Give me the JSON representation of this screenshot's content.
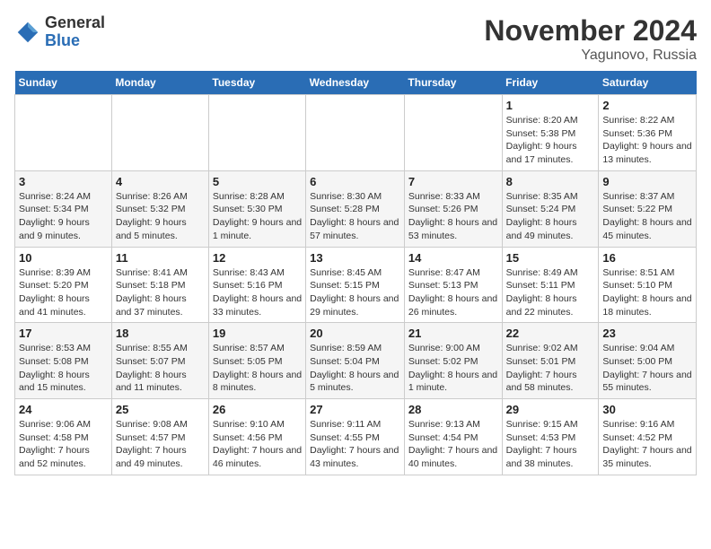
{
  "header": {
    "logo_general": "General",
    "logo_blue": "Blue",
    "month_title": "November 2024",
    "location": "Yagunovo, Russia"
  },
  "days_of_week": [
    "Sunday",
    "Monday",
    "Tuesday",
    "Wednesday",
    "Thursday",
    "Friday",
    "Saturday"
  ],
  "weeks": [
    [
      {
        "day": "",
        "info": ""
      },
      {
        "day": "",
        "info": ""
      },
      {
        "day": "",
        "info": ""
      },
      {
        "day": "",
        "info": ""
      },
      {
        "day": "",
        "info": ""
      },
      {
        "day": "1",
        "info": "Sunrise: 8:20 AM\nSunset: 5:38 PM\nDaylight: 9 hours and 17 minutes."
      },
      {
        "day": "2",
        "info": "Sunrise: 8:22 AM\nSunset: 5:36 PM\nDaylight: 9 hours and 13 minutes."
      }
    ],
    [
      {
        "day": "3",
        "info": "Sunrise: 8:24 AM\nSunset: 5:34 PM\nDaylight: 9 hours and 9 minutes."
      },
      {
        "day": "4",
        "info": "Sunrise: 8:26 AM\nSunset: 5:32 PM\nDaylight: 9 hours and 5 minutes."
      },
      {
        "day": "5",
        "info": "Sunrise: 8:28 AM\nSunset: 5:30 PM\nDaylight: 9 hours and 1 minute."
      },
      {
        "day": "6",
        "info": "Sunrise: 8:30 AM\nSunset: 5:28 PM\nDaylight: 8 hours and 57 minutes."
      },
      {
        "day": "7",
        "info": "Sunrise: 8:33 AM\nSunset: 5:26 PM\nDaylight: 8 hours and 53 minutes."
      },
      {
        "day": "8",
        "info": "Sunrise: 8:35 AM\nSunset: 5:24 PM\nDaylight: 8 hours and 49 minutes."
      },
      {
        "day": "9",
        "info": "Sunrise: 8:37 AM\nSunset: 5:22 PM\nDaylight: 8 hours and 45 minutes."
      }
    ],
    [
      {
        "day": "10",
        "info": "Sunrise: 8:39 AM\nSunset: 5:20 PM\nDaylight: 8 hours and 41 minutes."
      },
      {
        "day": "11",
        "info": "Sunrise: 8:41 AM\nSunset: 5:18 PM\nDaylight: 8 hours and 37 minutes."
      },
      {
        "day": "12",
        "info": "Sunrise: 8:43 AM\nSunset: 5:16 PM\nDaylight: 8 hours and 33 minutes."
      },
      {
        "day": "13",
        "info": "Sunrise: 8:45 AM\nSunset: 5:15 PM\nDaylight: 8 hours and 29 minutes."
      },
      {
        "day": "14",
        "info": "Sunrise: 8:47 AM\nSunset: 5:13 PM\nDaylight: 8 hours and 26 minutes."
      },
      {
        "day": "15",
        "info": "Sunrise: 8:49 AM\nSunset: 5:11 PM\nDaylight: 8 hours and 22 minutes."
      },
      {
        "day": "16",
        "info": "Sunrise: 8:51 AM\nSunset: 5:10 PM\nDaylight: 8 hours and 18 minutes."
      }
    ],
    [
      {
        "day": "17",
        "info": "Sunrise: 8:53 AM\nSunset: 5:08 PM\nDaylight: 8 hours and 15 minutes."
      },
      {
        "day": "18",
        "info": "Sunrise: 8:55 AM\nSunset: 5:07 PM\nDaylight: 8 hours and 11 minutes."
      },
      {
        "day": "19",
        "info": "Sunrise: 8:57 AM\nSunset: 5:05 PM\nDaylight: 8 hours and 8 minutes."
      },
      {
        "day": "20",
        "info": "Sunrise: 8:59 AM\nSunset: 5:04 PM\nDaylight: 8 hours and 5 minutes."
      },
      {
        "day": "21",
        "info": "Sunrise: 9:00 AM\nSunset: 5:02 PM\nDaylight: 8 hours and 1 minute."
      },
      {
        "day": "22",
        "info": "Sunrise: 9:02 AM\nSunset: 5:01 PM\nDaylight: 7 hours and 58 minutes."
      },
      {
        "day": "23",
        "info": "Sunrise: 9:04 AM\nSunset: 5:00 PM\nDaylight: 7 hours and 55 minutes."
      }
    ],
    [
      {
        "day": "24",
        "info": "Sunrise: 9:06 AM\nSunset: 4:58 PM\nDaylight: 7 hours and 52 minutes."
      },
      {
        "day": "25",
        "info": "Sunrise: 9:08 AM\nSunset: 4:57 PM\nDaylight: 7 hours and 49 minutes."
      },
      {
        "day": "26",
        "info": "Sunrise: 9:10 AM\nSunset: 4:56 PM\nDaylight: 7 hours and 46 minutes."
      },
      {
        "day": "27",
        "info": "Sunrise: 9:11 AM\nSunset: 4:55 PM\nDaylight: 7 hours and 43 minutes."
      },
      {
        "day": "28",
        "info": "Sunrise: 9:13 AM\nSunset: 4:54 PM\nDaylight: 7 hours and 40 minutes."
      },
      {
        "day": "29",
        "info": "Sunrise: 9:15 AM\nSunset: 4:53 PM\nDaylight: 7 hours and 38 minutes."
      },
      {
        "day": "30",
        "info": "Sunrise: 9:16 AM\nSunset: 4:52 PM\nDaylight: 7 hours and 35 minutes."
      }
    ]
  ]
}
